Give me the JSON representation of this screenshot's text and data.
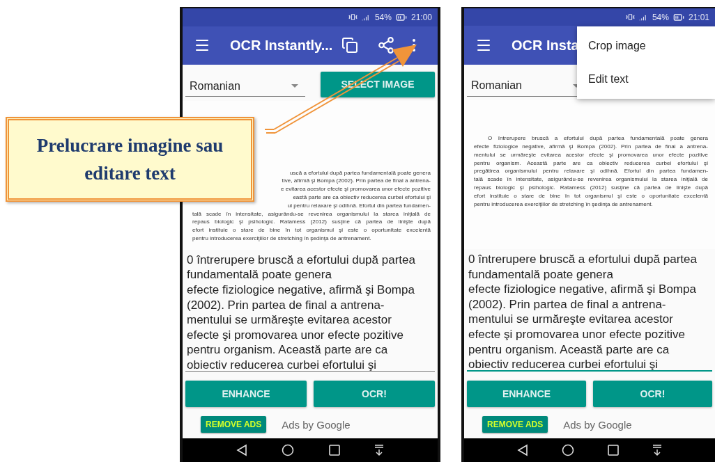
{
  "callout": {
    "text": "Prelucrare imagine sau editare text"
  },
  "phones": [
    {
      "status": {
        "battery": "54%",
        "time": "21:00"
      },
      "app_bar": {
        "title": "OCR Instantly...",
        "actions": [
          {
            "kind": "copy"
          },
          {
            "kind": "share"
          },
          {
            "kind": "more"
          }
        ]
      },
      "language": "Romanian",
      "select_button": "SELECT IMAGE",
      "scan_lines": [
        {
          "kind": "covered",
          "text": "uscă a efortului după partea fundamentală poate genera"
        },
        {
          "kind": "covered",
          "text": "tive, afirmă şi Bompa (2002). Prin partea de final a antrena-"
        },
        {
          "kind": "covered",
          "text": "e evitarea acestor efecte şi promovarea unor efecte pozitive"
        },
        {
          "kind": "covered",
          "text": "eastă parte are ca obiectiv reducerea curbei efortului şi"
        },
        {
          "kind": "covered",
          "text": "ui pentru relaxare şi odihnă. Efortul din partea fundamen-"
        },
        {
          "kind": "plain",
          "text": "tală scade în intensitate, asigurându-se revenirea organismului la starea iniţială de"
        },
        {
          "kind": "plain",
          "text": "repaus biologic şi psihologic. Ratamess (2012) susţine că partea de linişte după"
        },
        {
          "kind": "plain",
          "text": "efort instituie o stare de bine în tot organismul şi este o oportunitate excelentă"
        },
        {
          "kind": "last",
          "text": "pentru introducerea exerciţiilor de stretching în şedinţa de antrenament."
        }
      ],
      "ocr_text": {
        "focused": false,
        "lines": [
          "0 întrerupere bruscă a efortului după partea",
          "fundamentală poate genera",
          "efecte fiziologice negative, afirmă şi Bompa",
          "(2002). Prin partea de final a antrena-",
          "mentului se urmăreşte evitarea acestor",
          "efecte şi promovarea unor efecte pozitive",
          "pentru organism. Această parte are ca",
          "obiectiv reducerea curbei efortului şi"
        ]
      },
      "buttons": [
        "ENHANCE",
        "OCR!"
      ],
      "remove_ads": "REMOVE ADS",
      "ads_label": "Ads by Google"
    },
    {
      "status": {
        "battery": "54%",
        "time": "21:01"
      },
      "app_bar": {
        "title": "OCR Insta"
      },
      "language": "Romanian",
      "scan_lines": [
        {
          "kind": "indented",
          "text": "O întrerupere bruscă a efortului după partea fundamentală poate genera"
        },
        {
          "kind": "plain",
          "text": "efecte fiziologice negative, afirmă şi Bompa (2002). Prin partea de final a antrena-"
        },
        {
          "kind": "plain",
          "text": "mentului se urmăreşte evitarea acestor efecte şi promovarea unor efecte pozitive"
        },
        {
          "kind": "plain",
          "text": "pentru organism. Această parte are ca obiectiv reducerea curbei efortului şi"
        },
        {
          "kind": "plain",
          "text": "pregătirea organismului pentru relaxare şi odihnă. Efortul din partea fundamen-"
        },
        {
          "kind": "plain",
          "text": "tală scade în intensitate, asigurându-se revenirea organismului la starea iniţială de"
        },
        {
          "kind": "plain",
          "text": "repaus biologic şi psihologic. Ratamess (2012) susţine că partea de linişte după"
        },
        {
          "kind": "plain",
          "text": "efort instituie o stare de bine în tot organismul şi este o oportunitate excelentă"
        },
        {
          "kind": "last",
          "text": "pentru introducerea exerciţiilor de stretching în şedinţa de antrenament."
        }
      ],
      "ocr_text": {
        "focused": true,
        "lines": [
          "0 întrerupere bruscă a efortului după partea",
          "fundamentală poate genera",
          "efecte fiziologice negative, afirmă şi Bompa",
          "(2002). Prin partea de final a antrena-",
          "mentului se urmăreşte evitarea acestor",
          "efecte şi promovarea unor efecte pozitive",
          "pentru organism. Această parte are ca",
          "obiectiv reducerea curbei efortului şi"
        ]
      },
      "buttons": [
        "ENHANCE",
        "OCR!"
      ],
      "remove_ads": "REMOVE ADS",
      "ads_label": "Ads by Google",
      "menu": [
        {
          "label": "Crop image"
        },
        {
          "label": "Edit text"
        }
      ]
    }
  ]
}
